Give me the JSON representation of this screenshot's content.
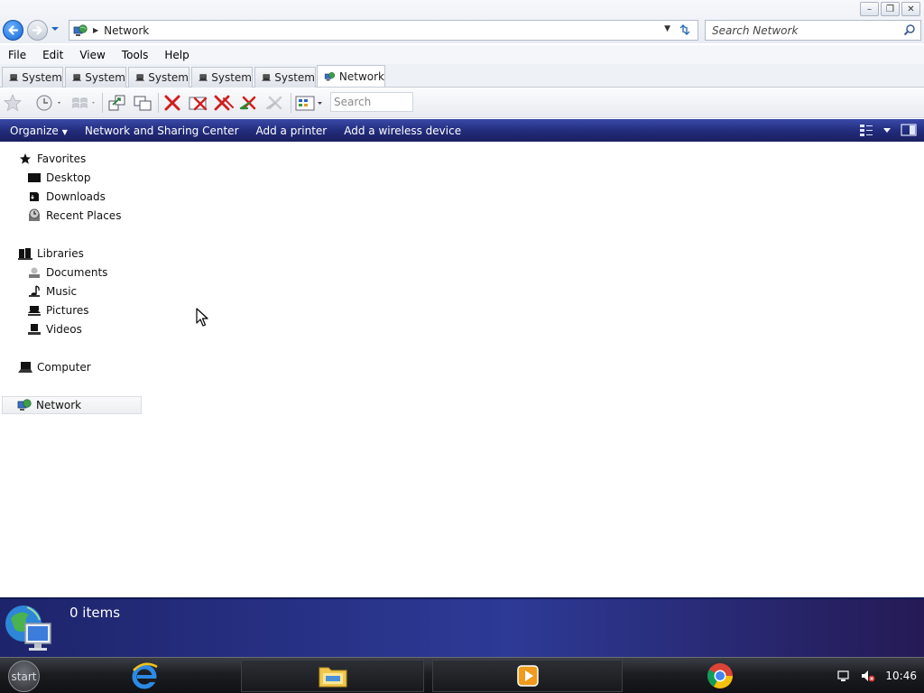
{
  "window": {
    "controls": {
      "minimize": "–",
      "restore": "❐",
      "close": "✕"
    }
  },
  "address": {
    "path": "Network",
    "search_placeholder": "Search Network"
  },
  "menu": [
    "File",
    "Edit",
    "View",
    "Tools",
    "Help"
  ],
  "tabs": [
    {
      "label": "System",
      "active": false
    },
    {
      "label": "System",
      "active": false
    },
    {
      "label": "System",
      "active": false
    },
    {
      "label": "System",
      "active": false
    },
    {
      "label": "System",
      "active": false
    },
    {
      "label": "Network",
      "active": true
    }
  ],
  "toolbar": {
    "search_placeholder": "Search"
  },
  "commands": {
    "organize": "Organize",
    "network_sharing": "Network and Sharing Center",
    "add_printer": "Add a printer",
    "add_wireless": "Add a wireless device"
  },
  "nav": {
    "favorites": "Favorites",
    "desktop": "Desktop",
    "downloads": "Downloads",
    "recent_places": "Recent Places",
    "libraries": "Libraries",
    "documents": "Documents",
    "music": "Music",
    "pictures": "Pictures",
    "videos": "Videos",
    "computer": "Computer",
    "network": "Network"
  },
  "details": {
    "item_count": "0 items"
  },
  "taskbar": {
    "start_label": "start",
    "clock": "10:46"
  },
  "colors": {
    "command_bar": "#232d7d",
    "details_pane": "#2d3a96",
    "accent_blue": "#1567d6"
  }
}
